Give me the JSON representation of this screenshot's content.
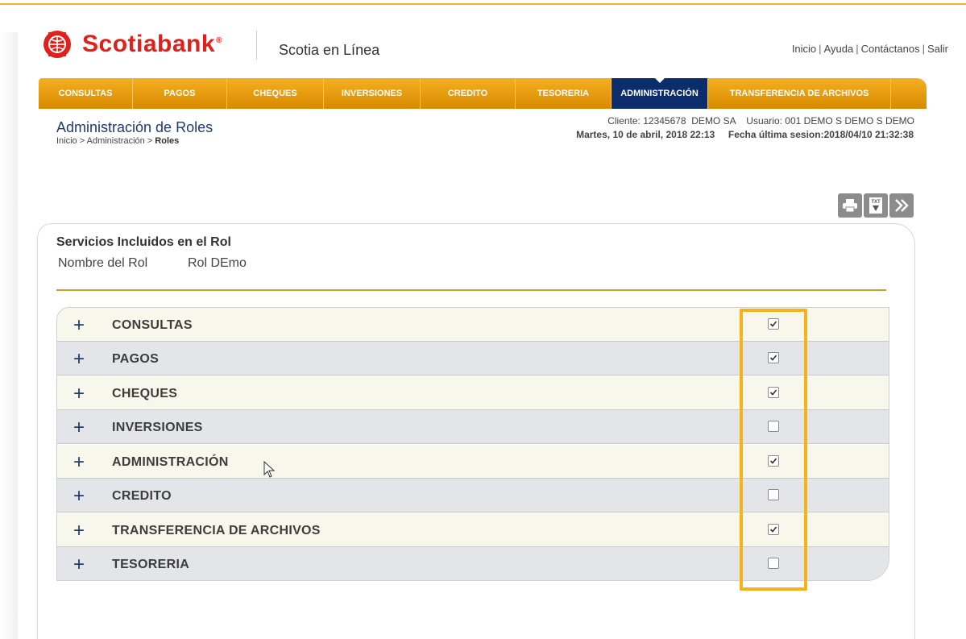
{
  "header": {
    "logo_text": "Scotiabank",
    "logo_reg": "®",
    "app_name": "Scotia en Línea",
    "links": [
      "Inicio",
      "Ayuda",
      "Contáctanos",
      "Salir"
    ]
  },
  "nav": {
    "items": [
      {
        "label": "CONSULTAS"
      },
      {
        "label": "PAGOS"
      },
      {
        "label": "CHEQUES"
      },
      {
        "label": "INVERSIONES"
      },
      {
        "label": "CREDITO"
      },
      {
        "label": "TESORERIA"
      },
      {
        "label": "ADMINISTRACIÓN",
        "active": true
      },
      {
        "label": "TRANSFERENCIA DE ARCHIVOS"
      }
    ]
  },
  "page": {
    "title": "Administración de Roles",
    "breadcrumb_prefix": "Inicio > Administración > ",
    "breadcrumb_current": "Roles",
    "client_info": "Cliente: 12345678  DEMO SA    Usuario: 001 DEMO S DEMO S DEMO",
    "date_info": "Martes, 10 de abril, 2018 22:13     Fecha última sesion:2018/04/10 21:32:38"
  },
  "actions": {
    "print_icon": "printer-icon",
    "txt_icon": "txt-export-icon",
    "next_icon": "double-chevron-right-icon"
  },
  "panel": {
    "title": "Servicios Incluidos en el Rol",
    "role_label": "Nombre del Rol",
    "role_value": "Rol DEmo"
  },
  "services": [
    {
      "label": "CONSULTAS",
      "checked": true
    },
    {
      "label": "PAGOS",
      "checked": true
    },
    {
      "label": "CHEQUES",
      "checked": true
    },
    {
      "label": "INVERSIONES",
      "checked": false
    },
    {
      "label": "ADMINISTRACIÓN",
      "checked": true
    },
    {
      "label": "CREDITO",
      "checked": false
    },
    {
      "label": "TRANSFERENCIA DE ARCHIVOS",
      "checked": true
    },
    {
      "label": "TESORERIA",
      "checked": false
    }
  ],
  "colors": {
    "nav_gold": "#e9a10f",
    "nav_active": "#0b2d6b",
    "brand_red": "#e0201b",
    "highlight": "#f5b21a"
  }
}
